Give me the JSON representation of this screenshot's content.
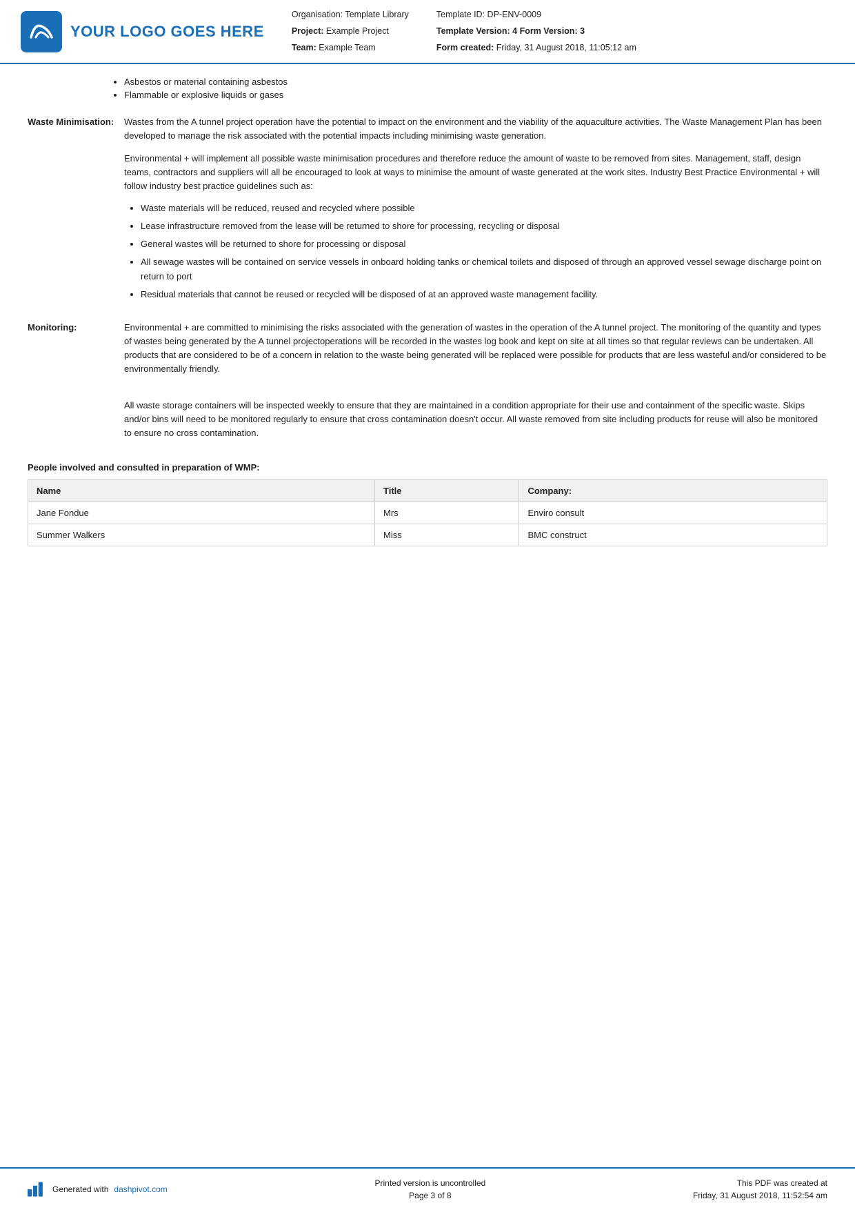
{
  "header": {
    "logo_text": "YOUR LOGO GOES HERE",
    "org_label": "Organisation:",
    "org_value": "Template Library",
    "project_label": "Project:",
    "project_value": "Example Project",
    "team_label": "Team:",
    "team_value": "Example Team",
    "template_id_label": "Template ID:",
    "template_id_value": "DP-ENV-0009",
    "template_version_label": "Template Version:",
    "template_version_value": "4",
    "form_version_label": "Form Version:",
    "form_version_value": "3",
    "form_created_label": "Form created:",
    "form_created_value": "Friday, 31 August 2018, 11:05:12 am"
  },
  "intro": {
    "bullets": [
      "Asbestos or material containing asbestos",
      "Flammable or explosive liquids or gases"
    ]
  },
  "waste_minimisation": {
    "label": "Waste Minimisation:",
    "paragraphs": [
      "Wastes from the A tunnel project operation have the potential to impact on the environment and the viability of the aquaculture activities. The Waste Management Plan has been developed to manage the risk associated with the potential impacts including minimising waste generation.",
      "Environmental + will implement all possible waste minimisation procedures and therefore reduce the amount of waste to be removed from sites. Management, staff, design teams, contractors and suppliers will all be encouraged to look at ways to minimise the amount of waste generated at the work sites. Industry Best Practice Environmental + will follow industry best practice guidelines such as:"
    ],
    "bullets": [
      "Waste materials will be reduced, reused and recycled where possible",
      "Lease infrastructure removed from the lease will be returned to shore for processing, recycling or disposal",
      "General wastes will be returned to shore for processing or disposal",
      "All sewage wastes will be contained on service vessels in onboard holding tanks or chemical toilets and disposed of through an approved vessel sewage discharge point on return to port",
      "Residual materials that cannot be reused or recycled will be disposed of at an approved waste management facility."
    ]
  },
  "monitoring": {
    "label": "Monitoring:",
    "paragraphs": [
      "Environmental + are committed to minimising the risks associated with the generation of wastes in the operation of the A tunnel project. The monitoring of the quantity and types of wastes being generated by the A tunnel projectoperations will be recorded in the wastes log book and kept on site at all times so that regular reviews can be undertaken. All products that are considered to be of a concern in relation to the waste being generated will be replaced were possible for products that are less wasteful and/or considered to be environmentally friendly.",
      "All waste storage containers will be inspected weekly to ensure that they are maintained in a condition appropriate for their use and containment of the specific waste. Skips and/or bins will need to be monitored regularly to ensure that cross contamination doesn't occur. All waste removed from site including products for reuse will also be monitored to ensure no cross contamination."
    ]
  },
  "people_section": {
    "heading": "People involved and consulted in preparation of WMP:",
    "columns": [
      "Name",
      "Title",
      "Company:"
    ],
    "rows": [
      {
        "name": "Jane Fondue",
        "title": "Mrs",
        "company": "Enviro consult"
      },
      {
        "name": "Summer Walkers",
        "title": "Miss",
        "company": "BMC construct"
      }
    ]
  },
  "footer": {
    "generated_text": "Generated with",
    "dashpivot_link": "dashpivot.com",
    "center_line1": "Printed version is uncontrolled",
    "center_line2": "Page 3 of 8",
    "right_line1": "This PDF was created at",
    "right_line2": "Friday, 31 August 2018, 11:52:54 am"
  }
}
